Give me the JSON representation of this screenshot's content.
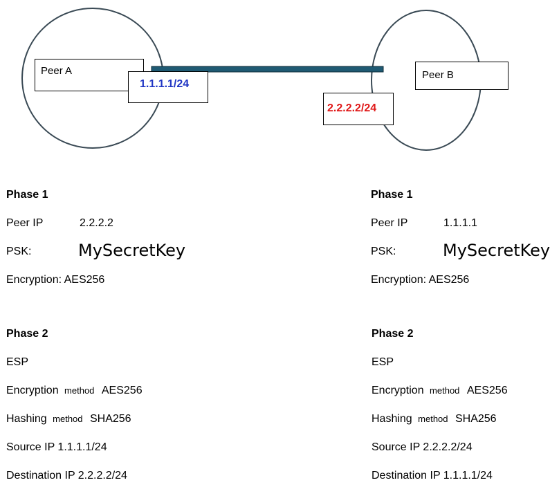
{
  "peers": {
    "a": {
      "name": "Peer A",
      "ip": "1.1.1.1/24",
      "ip_color": "#1f35c4"
    },
    "b": {
      "name": "Peer B",
      "ip": "2.2.2.2/24",
      "ip_color": "#e01818"
    }
  },
  "link_color": "#1f5a73",
  "left": {
    "phase1": {
      "heading": "Phase 1",
      "peer_ip_label": "Peer IP",
      "peer_ip_value": "2.2.2.2",
      "psk_label": "PSK:",
      "psk_value": "MySecretKey",
      "encryption": "Encryption: AES256"
    },
    "phase2": {
      "heading": "Phase 2",
      "protocol": "ESP",
      "enc_label": "Encryption",
      "enc_method": "method",
      "enc_value": "AES256",
      "hash_label": "Hashing",
      "hash_method": "method",
      "hash_value": "SHA256",
      "source": "Source IP 1.1.1.1/24",
      "destination": "Destination IP 2.2.2.2/24"
    }
  },
  "right": {
    "phase1": {
      "heading": "Phase 1",
      "peer_ip_label": "Peer IP",
      "peer_ip_value": "1.1.1.1",
      "psk_label": "PSK:",
      "psk_value": "MySecretKey",
      "encryption": "Encryption: AES256"
    },
    "phase2": {
      "heading": "Phase 2",
      "protocol": "ESP",
      "enc_label": "Encryption",
      "enc_method": "method",
      "enc_value": "AES256",
      "hash_label": "Hashing",
      "hash_method": "method",
      "hash_value": "SHA256",
      "source": "Source IP 2.2.2.2/24",
      "destination": "Destination IP 1.1.1.1/24"
    }
  }
}
